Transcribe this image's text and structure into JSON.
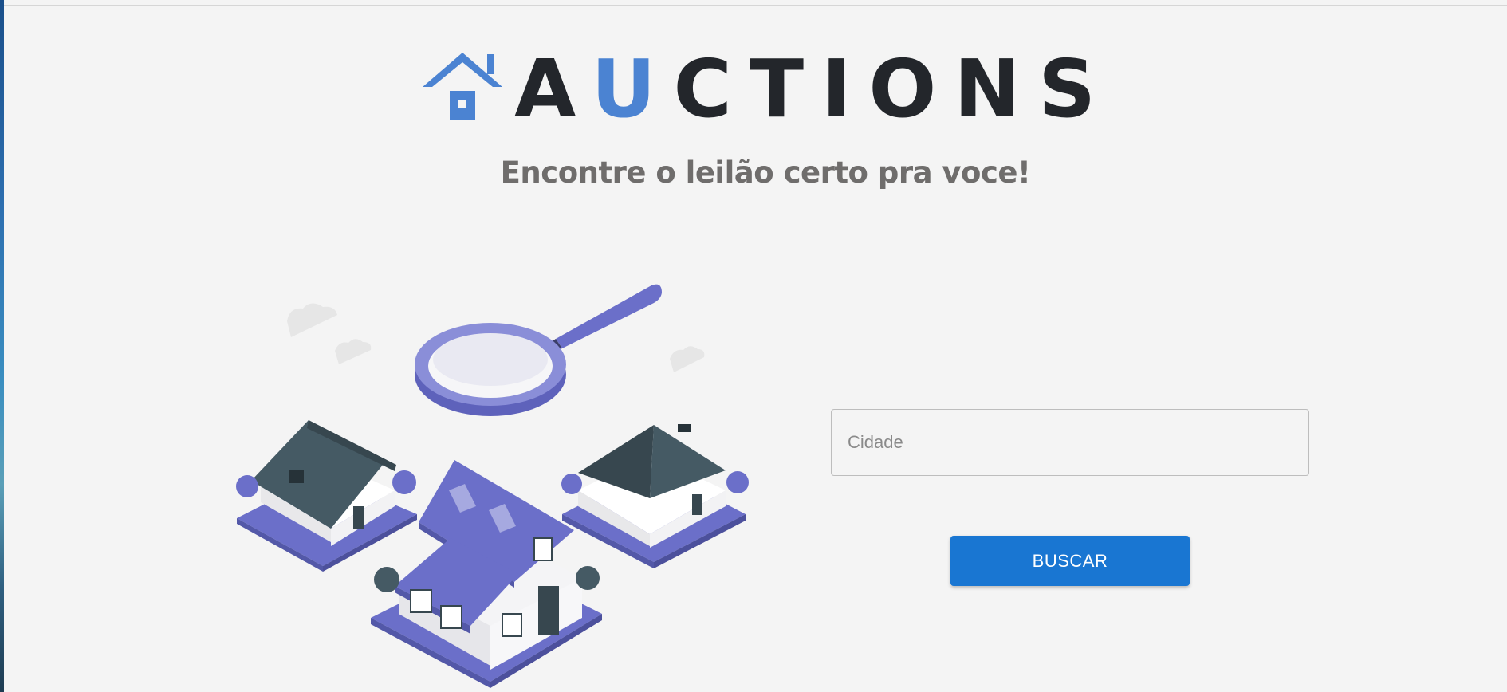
{
  "brand": {
    "logo_letters": [
      {
        "char": "A",
        "highlight": false
      },
      {
        "char": "U",
        "highlight": true
      },
      {
        "char": "C",
        "highlight": false
      },
      {
        "char": "T",
        "highlight": false
      },
      {
        "char": "I",
        "highlight": false
      },
      {
        "char": "O",
        "highlight": false
      },
      {
        "char": "N",
        "highlight": false
      },
      {
        "char": "S",
        "highlight": false
      }
    ],
    "logo_icon": "house-icon",
    "tagline": "Encontre o leilão certo pra voce!"
  },
  "illustration": {
    "name": "houses-with-magnifying-glass"
  },
  "search": {
    "city_placeholder": "Cidade",
    "city_value": "",
    "button_label": "BUSCAR"
  },
  "colors": {
    "background": "#f4f4f4",
    "brand_blue": "#4b83d2",
    "logo_dark": "#23262b",
    "tagline_gray": "#6f6d6c",
    "button_blue": "#1976d2",
    "illustration_purple": "#6b6fc9",
    "roof_dark": "#455a64"
  }
}
